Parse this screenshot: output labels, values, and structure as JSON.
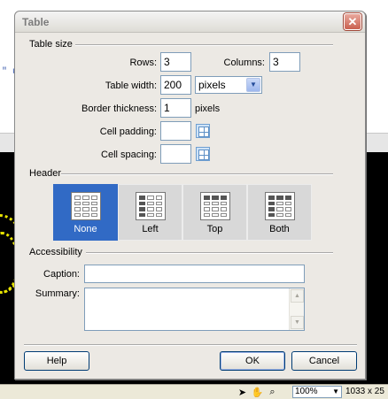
{
  "background": {
    "code_fragment": "\" u",
    "status_bar": {
      "tools": [
        "pointer-icon",
        "hand-icon",
        "zoom-icon"
      ],
      "zoom": "100%",
      "size": "1033 x 25"
    }
  },
  "dialog": {
    "title": "Table",
    "close_glyph": "✕",
    "sections": {
      "table_size": "Table size",
      "header": "Header",
      "accessibility": "Accessibility"
    },
    "rows_label": "Rows:",
    "rows_value": "3",
    "columns_label": "Columns:",
    "columns_value": "3",
    "table_width_label": "Table width:",
    "table_width_value": "200",
    "width_unit": "pixels",
    "border_label": "Border thickness:",
    "border_value": "1",
    "border_unit": "pixels",
    "cell_padding_label": "Cell padding:",
    "cell_padding_value": "",
    "cell_spacing_label": "Cell spacing:",
    "cell_spacing_value": "",
    "header_options": [
      {
        "label": "None",
        "selected": true
      },
      {
        "label": "Left",
        "selected": false
      },
      {
        "label": "Top",
        "selected": false
      },
      {
        "label": "Both",
        "selected": false
      }
    ],
    "caption_label": "Caption:",
    "caption_value": "",
    "summary_label": "Summary:",
    "summary_value": "",
    "buttons": {
      "help": "Help",
      "ok": "OK",
      "cancel": "Cancel"
    }
  }
}
